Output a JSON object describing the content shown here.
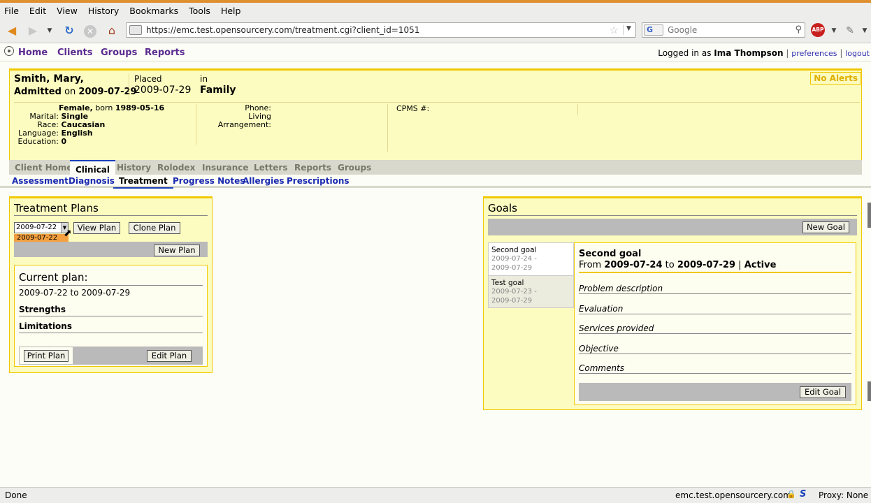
{
  "browser": {
    "menu": [
      "File",
      "Edit",
      "View",
      "History",
      "Bookmarks",
      "Tools",
      "Help"
    ],
    "url": "https://emc.test.opensourcery.com/treatment.cgi?client_id=1051",
    "search_placeholder": "Google",
    "search_engine": "G",
    "adblock_label": "ABP",
    "accent_color": "#e0902e"
  },
  "appnav": {
    "links": [
      "Home",
      "Clients",
      "Groups",
      "Reports"
    ],
    "logged_in_prefix": "Logged in as",
    "user": "Ima Thompson",
    "preferences": "preferences",
    "logout": "logout"
  },
  "client": {
    "name": "Smith, Mary,",
    "admitted_label": "Admitted",
    "admitted_on": "on",
    "admitted_date": "2009-07-29",
    "placed_label": "Placed",
    "placed_date": "2009-07-29",
    "in_label": "in",
    "placement": "Family",
    "alerts": "No Alerts",
    "gender": "Female,",
    "born_label": "born",
    "born": "1989-05-16",
    "marital_label": "Marital:",
    "marital": "Single",
    "race_label": "Race:",
    "race": "Caucasian",
    "language_label": "Language:",
    "language": "English",
    "education_label": "Education:",
    "education": "0",
    "phone_label": "Phone:",
    "living_label": "Living",
    "arrangement_label": "Arrangement:",
    "cpms_label": "CPMS #:"
  },
  "tabs": {
    "primary": [
      "Client Home",
      "Clinical",
      "History",
      "Rolodex",
      "Insurance",
      "Letters",
      "Reports",
      "Groups"
    ],
    "primary_active": "Clinical",
    "secondary": [
      "Assessment",
      "Diagnosis",
      "Treatment",
      "Progress Notes",
      "Allergies",
      "Prescriptions"
    ],
    "secondary_active": "Treatment"
  },
  "treatment": {
    "title": "Treatment Plans",
    "selected_plan": "2009-07-22",
    "highlighted_option": "2009-07-22",
    "view_plan": "View Plan",
    "clone_plan": "Clone Plan",
    "new_plan": "New Plan",
    "current_plan_heading": "Current plan:",
    "range": "2009-07-22 to 2009-07-29",
    "strengths": "Strengths",
    "limitations": "Limitations",
    "print_plan": "Print Plan",
    "edit_plan": "Edit Plan"
  },
  "goals": {
    "title": "Goals",
    "new_goal": "New Goal",
    "list": [
      {
        "title": "Second goal",
        "start": "2009-07-24 -",
        "end": "2009-07-29"
      },
      {
        "title": "Test goal",
        "start": "2009-07-23 -",
        "end": "2009-07-29"
      }
    ],
    "detail": {
      "title": "Second goal",
      "from_label": "From",
      "from": "2009-07-24",
      "to_label": "to",
      "to": "2009-07-29",
      "sep": "|",
      "status": "Active",
      "fields": [
        "Problem description",
        "Evaluation",
        "Services provided",
        "Objective",
        "Comments"
      ],
      "edit_goal": "Edit Goal"
    }
  },
  "status": {
    "left": "Done",
    "host": "emc.test.opensourcery.com",
    "s_icon": "S",
    "proxy": "Proxy: None"
  }
}
